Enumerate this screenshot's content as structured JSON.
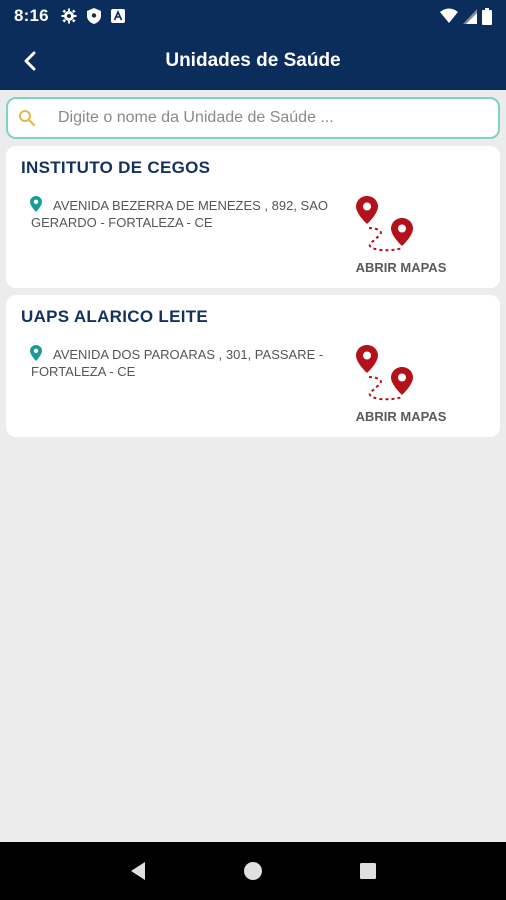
{
  "status_bar": {
    "time": "8:16",
    "left_icons": [
      "gear-icon",
      "shield-icon",
      "font-icon"
    ],
    "right_icons": [
      "wifi-icon",
      "signal-icon",
      "battery-icon"
    ]
  },
  "app_bar": {
    "title": "Unidades de Saúde",
    "background": "#0b2d5c"
  },
  "search": {
    "placeholder": "Digite o nome da Unidade de Saúde ...",
    "value": "",
    "border_color": "#7dd3c6"
  },
  "units": [
    {
      "name": "INSTITUTO DE CEGOS",
      "address": "AVENIDA BEZERRA DE MENEZES , 892, SAO GERARDO - FORTALEZA - CE",
      "action_label": "ABRIR MAPAS"
    },
    {
      "name": "UAPS ALARICO LEITE",
      "address": "AVENIDA DOS PAROARAS , 301, PASSARE - FORTALEZA - CE",
      "action_label": "ABRIR MAPAS"
    }
  ],
  "colors": {
    "accent_teal": "#1a9a9a",
    "map_red": "#b3121b",
    "title_navy": "#14325f"
  },
  "nav_bar": {
    "buttons": [
      "back-triangle-icon",
      "home-circle-icon",
      "recents-square-icon"
    ]
  }
}
